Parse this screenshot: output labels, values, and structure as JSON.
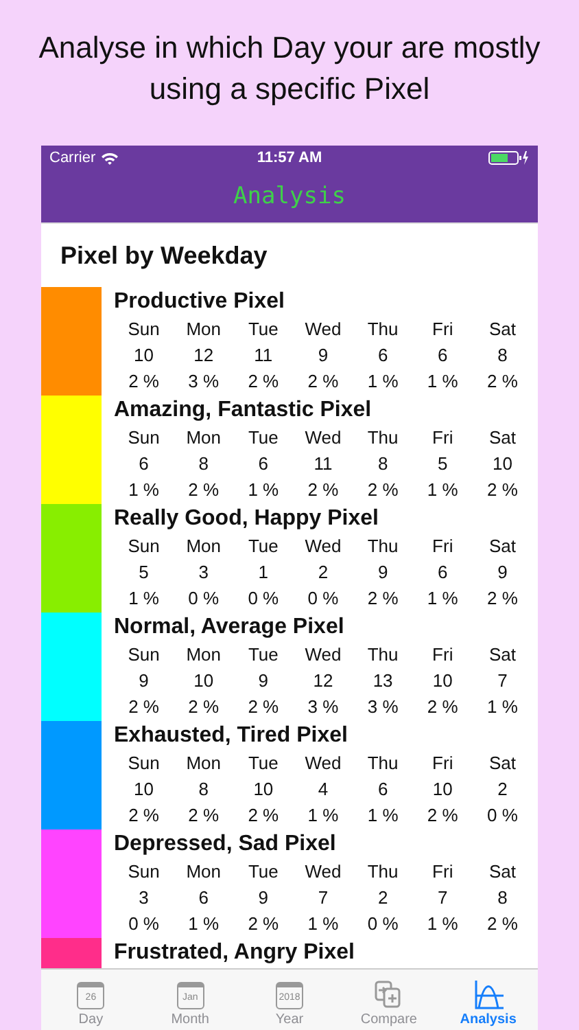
{
  "caption": "Analyse in which Day your are mostly using a specific Pixel",
  "status_bar": {
    "carrier": "Carrier",
    "time": "11:57 AM"
  },
  "nav_bar": {
    "title": "Analysis"
  },
  "section_title": "Pixel by Weekday",
  "pixels": [
    {
      "name": "Productive Pixel",
      "color": "#ff8c00",
      "days": [
        "Sun",
        "Mon",
        "Tue",
        "Wed",
        "Thu",
        "Fri",
        "Sat"
      ],
      "counts": [
        "10",
        "12",
        "11",
        "9",
        "6",
        "6",
        "8"
      ],
      "percents": [
        "2 %",
        "3 %",
        "2 %",
        "2 %",
        "1 %",
        "1 %",
        "2 %"
      ]
    },
    {
      "name": "Amazing, Fantastic Pixel",
      "color": "#ffff00",
      "days": [
        "Sun",
        "Mon",
        "Tue",
        "Wed",
        "Thu",
        "Fri",
        "Sat"
      ],
      "counts": [
        "6",
        "8",
        "6",
        "11",
        "8",
        "5",
        "10"
      ],
      "percents": [
        "1 %",
        "2 %",
        "1 %",
        "2 %",
        "2 %",
        "1 %",
        "2 %"
      ]
    },
    {
      "name": "Really Good, Happy Pixel",
      "color": "#88ee00",
      "days": [
        "Sun",
        "Mon",
        "Tue",
        "Wed",
        "Thu",
        "Fri",
        "Sat"
      ],
      "counts": [
        "5",
        "3",
        "1",
        "2",
        "9",
        "6",
        "9"
      ],
      "percents": [
        "1 %",
        "0 %",
        "0 %",
        "0 %",
        "2 %",
        "1 %",
        "2 %"
      ]
    },
    {
      "name": "Normal, Average Pixel",
      "color": "#00ffff",
      "days": [
        "Sun",
        "Mon",
        "Tue",
        "Wed",
        "Thu",
        "Fri",
        "Sat"
      ],
      "counts": [
        "9",
        "10",
        "9",
        "12",
        "13",
        "10",
        "7"
      ],
      "percents": [
        "2 %",
        "2 %",
        "2 %",
        "3 %",
        "3 %",
        "2 %",
        "1 %"
      ]
    },
    {
      "name": "Exhausted, Tired Pixel",
      "color": "#0099ff",
      "days": [
        "Sun",
        "Mon",
        "Tue",
        "Wed",
        "Thu",
        "Fri",
        "Sat"
      ],
      "counts": [
        "10",
        "8",
        "10",
        "4",
        "6",
        "10",
        "2"
      ],
      "percents": [
        "2 %",
        "2 %",
        "2 %",
        "1 %",
        "1 %",
        "2 %",
        "0 %"
      ]
    },
    {
      "name": "Depressed, Sad Pixel",
      "color": "#ff44ff",
      "days": [
        "Sun",
        "Mon",
        "Tue",
        "Wed",
        "Thu",
        "Fri",
        "Sat"
      ],
      "counts": [
        "3",
        "6",
        "9",
        "7",
        "2",
        "7",
        "8"
      ],
      "percents": [
        "0 %",
        "1 %",
        "2 %",
        "1 %",
        "0 %",
        "1 %",
        "2 %"
      ]
    },
    {
      "name": "Frustrated, Angry Pixel",
      "color": "#ff2d8a"
    }
  ],
  "tabs": [
    {
      "label": "Day",
      "kind": "calendar",
      "icon_text": "26",
      "selected": false
    },
    {
      "label": "Month",
      "kind": "calendar",
      "icon_text": "Jan",
      "selected": false
    },
    {
      "label": "Year",
      "kind": "calendar",
      "icon_text": "2018",
      "selected": false
    },
    {
      "label": "Compare",
      "kind": "compare",
      "selected": false
    },
    {
      "label": "Analysis",
      "kind": "curve",
      "selected": true
    }
  ]
}
